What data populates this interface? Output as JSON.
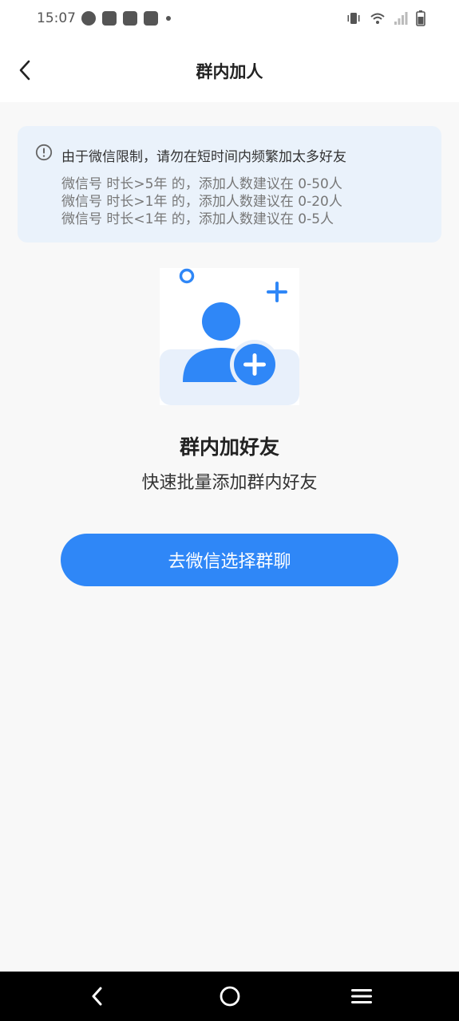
{
  "status_bar": {
    "time": "15:07"
  },
  "header": {
    "title": "群内加人",
    "back_icon": "chevron-left-icon"
  },
  "notice": {
    "icon": "info-circle-icon",
    "title": "由于微信限制，请勿在短时间内频繁加太多好友",
    "lines": [
      "微信号 时长>5年 的，添加人数建议在 0-50人",
      "微信号 时长>1年 的，添加人数建议在 0-20人",
      "微信号 时长<1年 的，添加人数建议在 0-5人"
    ]
  },
  "feature": {
    "icon": "add-user-icon",
    "title": "群内加好友",
    "subtitle": "快速批量添加群内好友"
  },
  "actions": {
    "primary_label": "去微信选择群聊"
  },
  "colors": {
    "accent": "#2f87f7",
    "notice_bg": "#eaf2fb",
    "page_bg": "#f8f8f8"
  }
}
